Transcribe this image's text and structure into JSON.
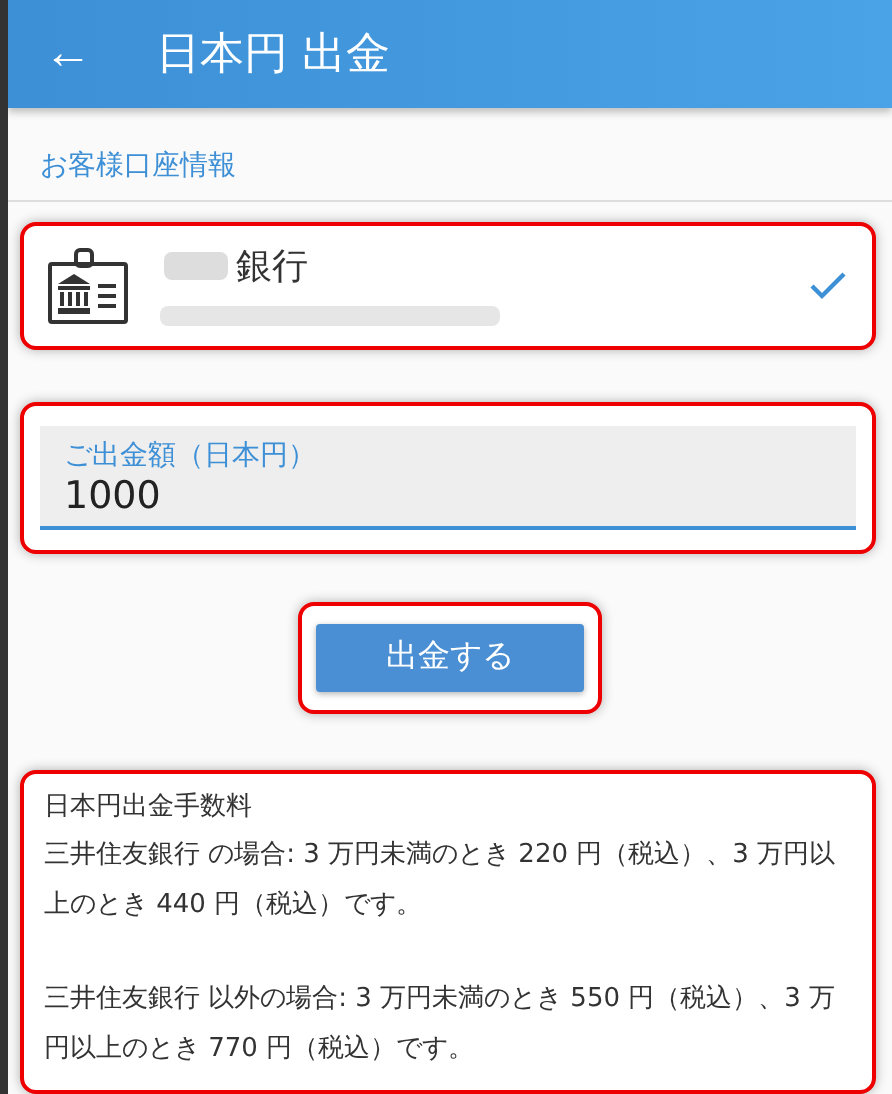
{
  "header": {
    "back": "←",
    "title": "日本円 出金"
  },
  "section_label": "お客様口座情報",
  "account": {
    "bank_suffix": "銀行",
    "selected": true
  },
  "amount_field": {
    "label": "ご出金額（日本円）",
    "value": "1000"
  },
  "submit_button": "出金する",
  "fees": {
    "title": "日本円出金手数料",
    "paragraphs": [
      "三井住友銀行 の場合: 3 万円未満のとき 220 円（税込）、3 万円以上のとき 440 円（税込）です。",
      "三井住友銀行 以外の場合: 3 万円未満のとき 550 円（税込）、3 万円以上のとき 770 円（税込）です。"
    ]
  }
}
